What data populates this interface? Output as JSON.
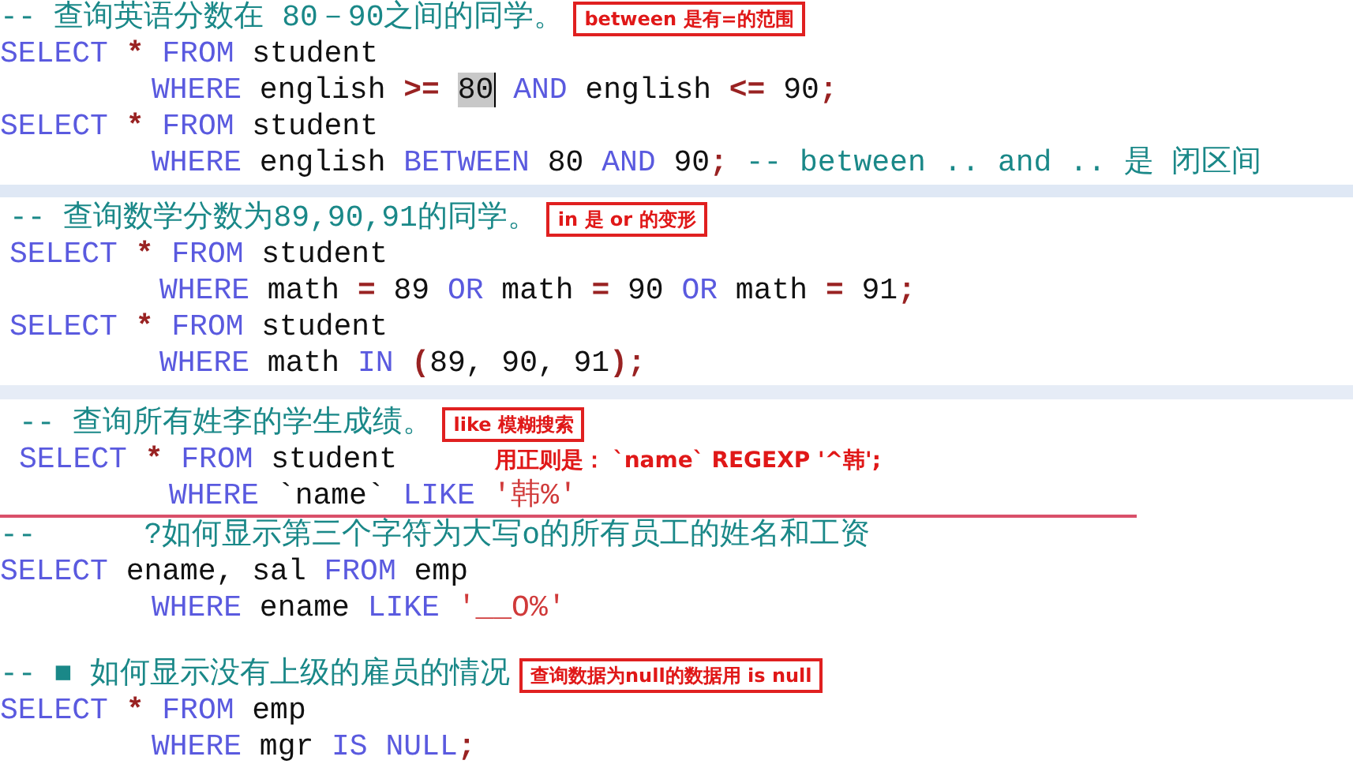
{
  "sections": [
    {
      "lines": [
        {
          "indented": false,
          "tokens": [
            {
              "text": "-- 查询英语分数在 80－90之间的同学。",
              "kind": "comment"
            }
          ],
          "note": {
            "text": "between 是有=的范围",
            "kind": "boxed"
          }
        },
        {
          "indented": false,
          "tokens": [
            {
              "text": "SELECT",
              "kind": "keyword"
            },
            {
              "text": " * ",
              "kind": "op"
            },
            {
              "text": "FROM",
              "kind": "keyword"
            },
            {
              "text": " student",
              "kind": "ident"
            }
          ]
        },
        {
          "indented": true,
          "tokens": [
            {
              "text": "WHERE",
              "kind": "keyword"
            },
            {
              "text": " english ",
              "kind": "ident"
            },
            {
              "text": ">= ",
              "kind": "op"
            },
            {
              "text": "80",
              "kind": "number",
              "highlighted": true,
              "caret": true
            },
            {
              "text": " AND",
              "kind": "keyword"
            },
            {
              "text": " english ",
              "kind": "ident"
            },
            {
              "text": "<=",
              "kind": "op"
            },
            {
              "text": " 90",
              "kind": "number"
            },
            {
              "text": ";",
              "kind": "op"
            }
          ]
        },
        {
          "indented": false,
          "tokens": [
            {
              "text": "SELECT",
              "kind": "keyword"
            },
            {
              "text": " * ",
              "kind": "op"
            },
            {
              "text": "FROM",
              "kind": "keyword"
            },
            {
              "text": " student",
              "kind": "ident"
            }
          ]
        },
        {
          "indented": true,
          "tokens": [
            {
              "text": "WHERE",
              "kind": "keyword"
            },
            {
              "text": " english ",
              "kind": "ident"
            },
            {
              "text": "BETWEEN",
              "kind": "keyword"
            },
            {
              "text": " 80 ",
              "kind": "number"
            },
            {
              "text": "AND",
              "kind": "keyword"
            },
            {
              "text": " 90",
              "kind": "number"
            },
            {
              "text": ";",
              "kind": "op"
            },
            {
              "text": " -- between .. and .. 是 闭区间",
              "kind": "comment"
            }
          ]
        }
      ]
    },
    {
      "lines": [
        {
          "indented": false,
          "tokens": [
            {
              "text": "-- 查询数学分数为89,90,91的同学。",
              "kind": "comment"
            }
          ],
          "note": {
            "text": "in 是 or 的变形",
            "kind": "boxed"
          }
        },
        {
          "indented": false,
          "tokens": [
            {
              "text": "SELECT",
              "kind": "keyword"
            },
            {
              "text": " * ",
              "kind": "op"
            },
            {
              "text": "FROM",
              "kind": "keyword"
            },
            {
              "text": " student",
              "kind": "ident"
            }
          ]
        },
        {
          "indented": true,
          "tokens": [
            {
              "text": "WHERE",
              "kind": "keyword"
            },
            {
              "text": " math ",
              "kind": "ident"
            },
            {
              "text": "=",
              "kind": "op"
            },
            {
              "text": " 89 ",
              "kind": "number"
            },
            {
              "text": "OR",
              "kind": "keyword"
            },
            {
              "text": " math ",
              "kind": "ident"
            },
            {
              "text": "=",
              "kind": "op"
            },
            {
              "text": " 90 ",
              "kind": "number"
            },
            {
              "text": "OR",
              "kind": "keyword"
            },
            {
              "text": " math ",
              "kind": "ident"
            },
            {
              "text": "=",
              "kind": "op"
            },
            {
              "text": " 91",
              "kind": "number"
            },
            {
              "text": ";",
              "kind": "op"
            }
          ]
        },
        {
          "indented": false,
          "tokens": [
            {
              "text": "SELECT",
              "kind": "keyword"
            },
            {
              "text": " * ",
              "kind": "op"
            },
            {
              "text": "FROM",
              "kind": "keyword"
            },
            {
              "text": " student",
              "kind": "ident"
            }
          ]
        },
        {
          "indented": true,
          "tokens": [
            {
              "text": "WHERE",
              "kind": "keyword"
            },
            {
              "text": " math ",
              "kind": "ident"
            },
            {
              "text": "IN",
              "kind": "keyword"
            },
            {
              "text": " (",
              "kind": "op"
            },
            {
              "text": "89, 90, 91",
              "kind": "number"
            },
            {
              "text": ");",
              "kind": "op"
            }
          ]
        }
      ]
    },
    {
      "lines": [
        {
          "indented": false,
          "tokens": [
            {
              "text": "-- 查询所有姓李的学生成绩。",
              "kind": "comment"
            }
          ],
          "note": {
            "text": "like 模糊搜索",
            "kind": "boxed"
          }
        },
        {
          "indented": false,
          "tokens": [
            {
              "text": "SELECT",
              "kind": "keyword"
            },
            {
              "text": " * ",
              "kind": "op"
            },
            {
              "text": "FROM",
              "kind": "keyword"
            },
            {
              "text": " student",
              "kind": "ident"
            }
          ],
          "note": {
            "text": "用正则是： `name` REGEXP '^韩';",
            "kind": "plain"
          }
        },
        {
          "indented": true,
          "tokens": [
            {
              "text": "WHERE",
              "kind": "keyword"
            },
            {
              "text": " `name` ",
              "kind": "ident"
            },
            {
              "text": "LIKE",
              "kind": "keyword"
            },
            {
              "text": " '韩%'",
              "kind": "string"
            }
          ]
        }
      ]
    },
    {
      "lines": [
        {
          "indented": false,
          "tokens": [
            {
              "text": "--      ?如何显示第三个字符为大写o的所有员工的姓名和工资",
              "kind": "comment"
            }
          ]
        },
        {
          "indented": false,
          "tokens": [
            {
              "text": "SELECT",
              "kind": "keyword"
            },
            {
              "text": " ename, sal ",
              "kind": "ident"
            },
            {
              "text": "FROM",
              "kind": "keyword"
            },
            {
              "text": " emp",
              "kind": "ident"
            }
          ]
        },
        {
          "indented": true,
          "tokens": [
            {
              "text": "WHERE",
              "kind": "keyword"
            },
            {
              "text": " ename ",
              "kind": "ident"
            },
            {
              "text": "LIKE",
              "kind": "keyword"
            },
            {
              "text": " '__O%'",
              "kind": "string"
            }
          ]
        }
      ]
    },
    {
      "lines": [
        {
          "indented": false,
          "tokens": [
            {
              "text": "-- ■ 如何显示没有上级的雇员的情况",
              "kind": "comment"
            }
          ],
          "note": {
            "text": "查询数据为null的数据用 is null",
            "kind": "boxed"
          }
        },
        {
          "indented": false,
          "tokens": [
            {
              "text": "SELECT",
              "kind": "keyword"
            },
            {
              "text": " * ",
              "kind": "op"
            },
            {
              "text": "FROM",
              "kind": "keyword"
            },
            {
              "text": " emp",
              "kind": "ident"
            }
          ]
        },
        {
          "indented": true,
          "tokens": [
            {
              "text": "WHERE",
              "kind": "keyword"
            },
            {
              "text": " mgr ",
              "kind": "ident"
            },
            {
              "text": "IS NULL",
              "kind": "keyword"
            },
            {
              "text": ";",
              "kind": "op"
            }
          ]
        }
      ]
    }
  ]
}
